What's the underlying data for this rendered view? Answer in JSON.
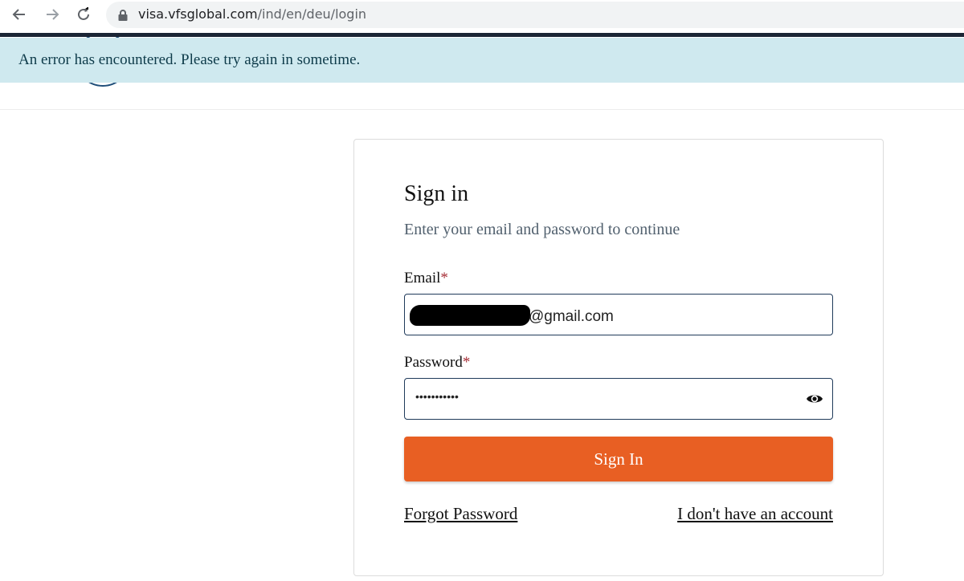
{
  "browser": {
    "url_host": "visa.vfsglobal.com",
    "url_path": "/ind/en/deu/login",
    "icons": [
      "back-arrow-icon",
      "forward-arrow-icon",
      "reload-icon",
      "lock-icon"
    ]
  },
  "banner": {
    "message": "An error has encountered. Please try again in sometime.",
    "background": "#cfe9ef"
  },
  "signin": {
    "title": "Sign in",
    "subtitle": "Enter your email and password to continue",
    "email_label": "Email",
    "email_required": "*",
    "email_value_visible": "@gmail.com",
    "password_label": "Password",
    "password_required": "*",
    "password_masked": "•••••••••••",
    "submit_label": "Sign In",
    "forgot_link": "Forgot Password",
    "no_account_link": "I don't have an account",
    "accent": "#e85f23"
  }
}
